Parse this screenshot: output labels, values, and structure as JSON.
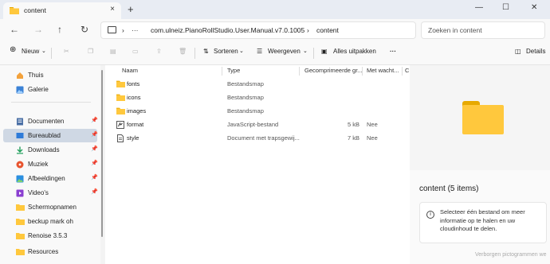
{
  "tab": {
    "title": "content",
    "close": "×",
    "new_tab": "+"
  },
  "window": {
    "minimize": "—",
    "maximize": "☐",
    "close": "✕"
  },
  "nav": {
    "back": "←",
    "forward": "→",
    "up": "↑",
    "refresh": "↻"
  },
  "address": {
    "separator": "›",
    "ellipsis": "···",
    "segments": [
      "com.ulneiz.PianoRollStudio.User.Manual.v7.0.1005",
      "content"
    ]
  },
  "search": {
    "placeholder": "Zoeken in content"
  },
  "toolbar": {
    "new_label": "Nieuw",
    "sort_label": "Sorteren",
    "view_label": "Weergeven",
    "extract_label": "Alles uitpakken",
    "more_label": "···",
    "details_label": "Details"
  },
  "sidebar": {
    "items": [
      {
        "label": "Thuis",
        "icon": "home-icon",
        "pinned": false
      },
      {
        "label": "Galerie",
        "icon": "gallery-icon",
        "pinned": false
      },
      {
        "label": "Documenten",
        "icon": "documents-icon",
        "pinned": true
      },
      {
        "label": "Bureaublad",
        "icon": "desktop-icon",
        "pinned": true,
        "selected": true
      },
      {
        "label": "Downloads",
        "icon": "download-icon",
        "pinned": true
      },
      {
        "label": "Muziek",
        "icon": "music-icon",
        "pinned": true
      },
      {
        "label": "Afbeeldingen",
        "icon": "pictures-icon",
        "pinned": true
      },
      {
        "label": "Video's",
        "icon": "videos-icon",
        "pinned": true
      },
      {
        "label": "Schermopnamen",
        "icon": "folder-icon",
        "pinned": false
      },
      {
        "label": "beckup mark oh",
        "icon": "folder-icon",
        "pinned": false
      },
      {
        "label": "Renoise 3.5.3",
        "icon": "folder-icon",
        "pinned": false
      },
      {
        "label": "Resources",
        "icon": "folder-icon",
        "pinned": false
      }
    ]
  },
  "columns": [
    "Naam",
    "Type",
    "Gecomprimeerde gr...",
    "Met wacht...",
    "C"
  ],
  "files": [
    {
      "name": "fonts",
      "type": "Bestandsmap",
      "size": "",
      "password": "",
      "icon": "folder-icon"
    },
    {
      "name": "icons",
      "type": "Bestandsmap",
      "size": "",
      "password": "",
      "icon": "folder-icon"
    },
    {
      "name": "images",
      "type": "Bestandsmap",
      "size": "",
      "password": "",
      "icon": "folder-icon"
    },
    {
      "name": "format",
      "type": "JavaScript-bestand",
      "size": "5 kB",
      "password": "Nee",
      "icon": "javascript-file-icon"
    },
    {
      "name": "style",
      "type": "Document met trapsgewij...",
      "size": "7 kB",
      "password": "Nee",
      "icon": "css-file-icon"
    }
  ],
  "details": {
    "title": "content (5 items)",
    "info_text": "Selecteer één bestand om meer informatie op te halen en uw cloudinhoud te delen.",
    "info_icon": "i"
  },
  "taskbar_overlay": "Verborgen pictogrammen we",
  "colors": {
    "folder": "#ffc83d",
    "folder_tab": "#e7a900",
    "selected": "#cfd8e4",
    "accent": "#0067c0"
  }
}
